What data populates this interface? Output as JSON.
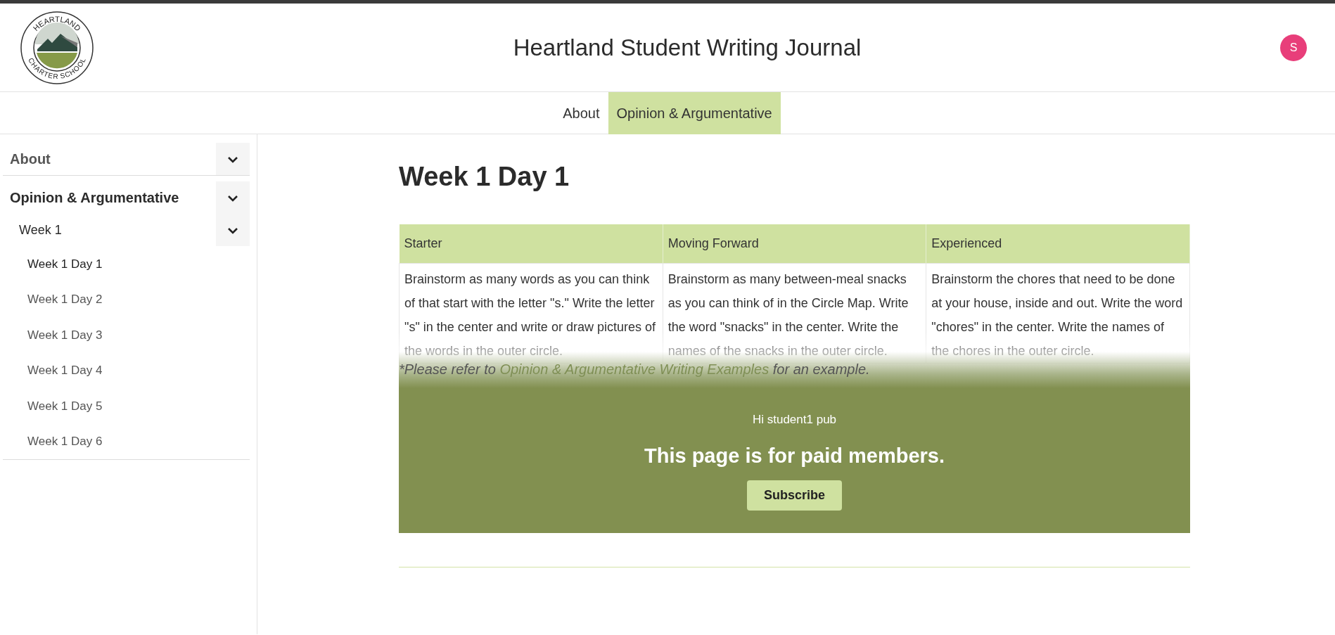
{
  "header": {
    "logo": {
      "top_text": "HEARTLAND",
      "bottom_text": "CHARTER SCHOOL"
    },
    "title": "Heartland Student Writing Journal",
    "avatar_initial": "S"
  },
  "nav_tabs": [
    {
      "label": "About",
      "selected": false
    },
    {
      "label": "Opinion & Argumentative",
      "selected": true
    }
  ],
  "sidebar": {
    "items": [
      {
        "label": "About"
      },
      {
        "label": "Opinion & Argumentative",
        "children": [
          {
            "label": "Week 1",
            "children": [
              {
                "label": "Week 1 Day 1",
                "selected": true
              },
              {
                "label": "Week 1 Day 2",
                "selected": false
              },
              {
                "label": "Week 1 Day 3",
                "selected": false
              },
              {
                "label": "Week 1 Day 4",
                "selected": false
              },
              {
                "label": "Week 1 Day 5",
                "selected": false
              },
              {
                "label": "Week 1 Day 6",
                "selected": false
              }
            ]
          }
        ]
      }
    ]
  },
  "page": {
    "heading": "Week 1 Day 1",
    "table": {
      "columns": [
        "Starter",
        "Moving Forward",
        "Experienced"
      ],
      "rows": [
        [
          "Brainstorm as many words as you can think of that start with the letter \"s.\" Write the letter \"s\" in the center and write or draw pictures of the words in the outer circle.",
          "Brainstorm as many between-meal snacks as you can think of in the Circle Map. Write the word \"snacks\" in the center. Write the names of the snacks in the outer circle.",
          "Brainstorm the chores that need to be done at your house, inside and out. Write the word \"chores\" in the center. Write the names of the chores in the outer circle."
        ]
      ]
    },
    "note": {
      "before": "*Please refer to ",
      "link": "Opinion & Argumentative Writing Examples",
      "after": " for an example."
    },
    "paywall": {
      "greeting": "Hi student1 pub",
      "message": "This page is for paid members.",
      "button": "Subscribe"
    }
  }
}
